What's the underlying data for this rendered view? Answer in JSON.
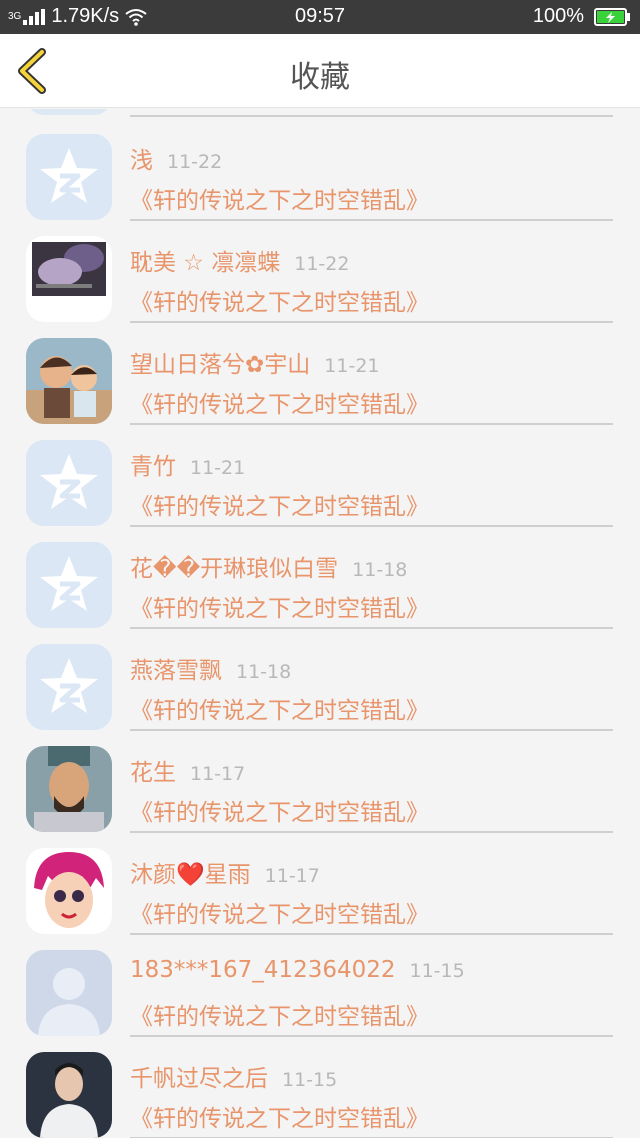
{
  "status_bar": {
    "network": "3G",
    "speed": "1.79K/s",
    "time": "09:57",
    "battery": "100%"
  },
  "header": {
    "title": "收藏"
  },
  "colors": {
    "accent_orange": "#e8956b",
    "date_gray": "#b8b8b8",
    "battery_green": "#3ad23a"
  },
  "items": [
    {
      "name": "浅",
      "date": "11-22",
      "book": "《轩的传说之下之时空错乱》",
      "avatar": "qzone-star-icon"
    },
    {
      "name": "耽美 ☆ 凛凛蝶",
      "date": "11-22",
      "book": "《轩的传说之下之时空错乱》",
      "avatar": "purple-photo"
    },
    {
      "name": "望山日落兮✿宇山",
      "date": "11-21",
      "book": "《轩的传说之下之时空错乱》",
      "avatar": "cartoon-family"
    },
    {
      "name": "青竹",
      "date": "11-21",
      "book": "《轩的传说之下之时空错乱》",
      "avatar": "qzone-star-icon"
    },
    {
      "name": "花��开琳琅似白雪",
      "date": "11-18",
      "book": "《轩的传说之下之时空错乱》",
      "avatar": "qzone-star-icon"
    },
    {
      "name": "燕落雪飘",
      "date": "11-18",
      "book": "《轩的传说之下之时空错乱》",
      "avatar": "qzone-star-icon"
    },
    {
      "name": "花生",
      "date": "11-17",
      "book": "《轩的传说之下之时空错乱》",
      "avatar": "warrior-portrait"
    },
    {
      "name": "沐颜❤️星雨",
      "date": "11-17",
      "book": "《轩的传说之下之时空错乱》",
      "avatar": "pink-hair-cartoon"
    },
    {
      "name": "183***167_412364022",
      "date": "11-15",
      "book": "《轩的传说之下之时空错乱》",
      "avatar": "default-person-icon"
    },
    {
      "name": "千帆过尽之后",
      "date": "11-15",
      "book": "《轩的传说之下之时空错乱》",
      "avatar": "man-in-white-photo"
    }
  ]
}
